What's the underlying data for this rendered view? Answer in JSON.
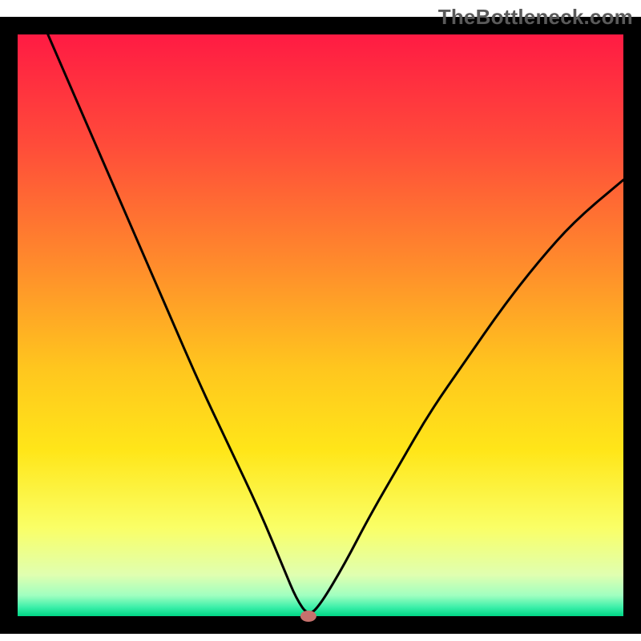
{
  "watermark": "TheBottleneck.com",
  "chart_data": {
    "type": "line",
    "title": "",
    "xlabel": "",
    "ylabel": "",
    "xlim": [
      0,
      100
    ],
    "ylim": [
      0,
      100
    ],
    "grid": false,
    "legend": false,
    "min_marker": {
      "x": 48,
      "y": 0,
      "color": "#c6716d"
    },
    "curve": [
      {
        "x": 5,
        "y": 100
      },
      {
        "x": 10,
        "y": 88
      },
      {
        "x": 15,
        "y": 76
      },
      {
        "x": 20,
        "y": 64
      },
      {
        "x": 25,
        "y": 52
      },
      {
        "x": 30,
        "y": 40
      },
      {
        "x": 35,
        "y": 29
      },
      {
        "x": 40,
        "y": 18
      },
      {
        "x": 44,
        "y": 8
      },
      {
        "x": 46,
        "y": 3
      },
      {
        "x": 48,
        "y": 0
      },
      {
        "x": 50,
        "y": 2
      },
      {
        "x": 54,
        "y": 9
      },
      {
        "x": 58,
        "y": 17
      },
      {
        "x": 63,
        "y": 26
      },
      {
        "x": 68,
        "y": 35
      },
      {
        "x": 74,
        "y": 44
      },
      {
        "x": 80,
        "y": 53
      },
      {
        "x": 86,
        "y": 61
      },
      {
        "x": 92,
        "y": 68
      },
      {
        "x": 100,
        "y": 75
      }
    ],
    "gradient_stops": [
      {
        "offset": 0.0,
        "color": "#ff1744"
      },
      {
        "offset": 0.2,
        "color": "#ff4b3a"
      },
      {
        "offset": 0.4,
        "color": "#ff8a2c"
      },
      {
        "offset": 0.58,
        "color": "#ffc61e"
      },
      {
        "offset": 0.72,
        "color": "#ffe619"
      },
      {
        "offset": 0.85,
        "color": "#faff66"
      },
      {
        "offset": 0.93,
        "color": "#e0ffb0"
      },
      {
        "offset": 0.965,
        "color": "#a0ffc0"
      },
      {
        "offset": 0.985,
        "color": "#3befa9"
      },
      {
        "offset": 1.0,
        "color": "#00d585"
      }
    ],
    "border_color": "#000000",
    "curve_color": "#000000"
  }
}
